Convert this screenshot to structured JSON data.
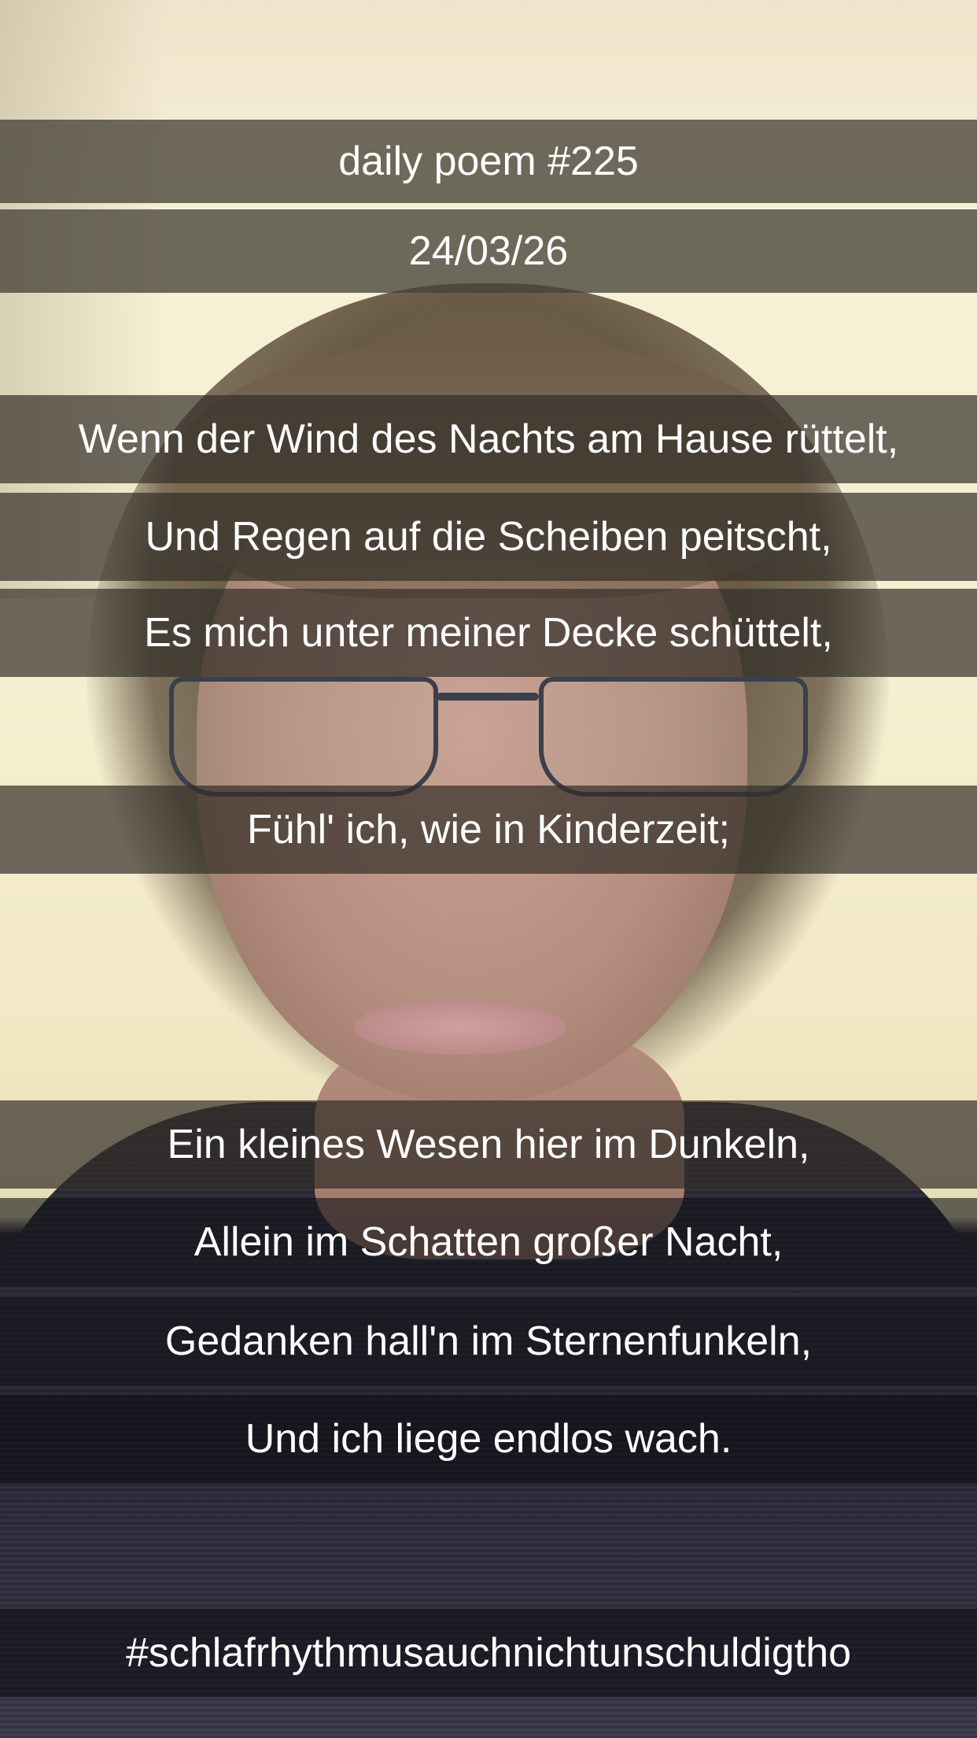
{
  "header": {
    "title": "daily poem #225",
    "date": "24/03/26"
  },
  "poem": {
    "stanza1": [
      "Wenn der Wind des Nachts am Hause rüttelt,",
      "Und Regen auf die Scheiben peitscht,",
      "Es mich unter meiner Decke schüttelt,",
      "Fühl' ich, wie in Kinderzeit;"
    ],
    "stanza2": [
      "Ein kleines Wesen hier im Dunkeln,",
      "Allein im Schatten großer Nacht,",
      "Gedanken hall'n im Sternenfunkeln,",
      "Und ich liege endlos wach."
    ]
  },
  "hashtag": "#schlafrhythmusauchnichtunschuldigtho",
  "colors": {
    "text": "#ffffff",
    "bar_overlay": "#46423a"
  }
}
